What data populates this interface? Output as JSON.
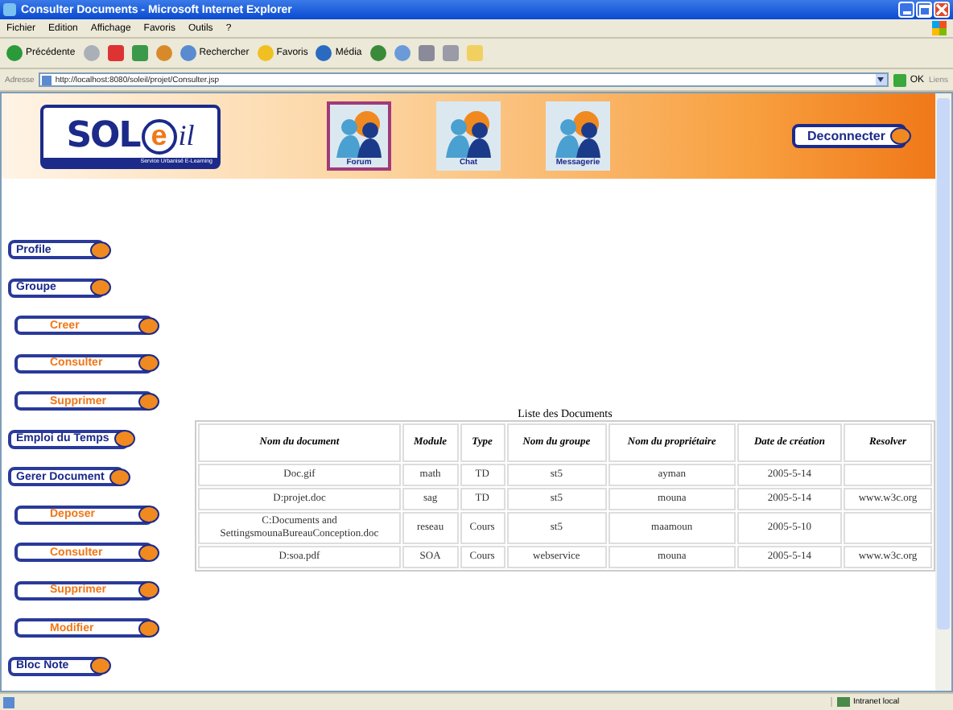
{
  "window": {
    "title": "Consulter Documents - Microsoft Internet Explorer"
  },
  "menu": [
    "Fichier",
    "Edition",
    "Affichage",
    "Favoris",
    "Outils",
    "?"
  ],
  "toolbar": [
    {
      "kind": "back",
      "label": "Précédente"
    },
    {
      "kind": "forward"
    },
    {
      "kind": "stop"
    },
    {
      "kind": "refresh"
    },
    {
      "kind": "home"
    },
    {
      "kind": "search",
      "label": "Rechercher"
    },
    {
      "kind": "favorites",
      "label": "Favoris"
    },
    {
      "kind": "media",
      "label": "Média"
    },
    {
      "kind": "history"
    },
    {
      "kind": "mail"
    },
    {
      "kind": "print"
    },
    {
      "kind": "edit"
    },
    {
      "kind": "folder"
    }
  ],
  "address": {
    "label": "Adresse",
    "url": "http://localhost:8080/soleil/projet/Consulter.jsp",
    "go": "OK",
    "links": "Liens"
  },
  "header": {
    "logo": "SOL",
    "logo_e": "e",
    "logo_end": "il",
    "tagline": "Service Urbanisé E-Learning",
    "nav": [
      {
        "label": "Forum",
        "selected": true
      },
      {
        "label": "Chat",
        "selected": false
      },
      {
        "label": "Messagerie",
        "selected": false
      }
    ],
    "logout": "Deconnecter"
  },
  "sidebar": [
    {
      "label": "Profile",
      "kind": "main"
    },
    {
      "label": "Groupe",
      "kind": "main"
    },
    {
      "label": "Creer",
      "kind": "sub"
    },
    {
      "label": "Consulter",
      "kind": "sub"
    },
    {
      "label": "Supprimer",
      "kind": "sub"
    },
    {
      "label": "Emploi du Temps",
      "kind": "main"
    },
    {
      "label": "Gerer Document",
      "kind": "main"
    },
    {
      "label": "Deposer",
      "kind": "sub"
    },
    {
      "label": "Consulter",
      "kind": "sub"
    },
    {
      "label": "Supprimer",
      "kind": "sub"
    },
    {
      "label": "Modifier",
      "kind": "sub"
    },
    {
      "label": "Bloc Note",
      "kind": "main"
    }
  ],
  "table": {
    "caption": "Liste des Documents",
    "columns": [
      "Nom du document",
      "Module",
      "Type",
      "Nom du groupe",
      "Nom du propriétaire",
      "Date de création",
      "Resolver"
    ],
    "rows": [
      [
        "Doc.gif",
        "math",
        "TD",
        "st5",
        "ayman",
        "2005-5-14",
        ""
      ],
      [
        "D:projet.doc",
        "sag",
        "TD",
        "st5",
        "mouna",
        "2005-5-14",
        "www.w3c.org"
      ],
      [
        "C:Documents and SettingsmounaBureauConception.doc",
        "reseau",
        "Cours",
        "st5",
        "maamoun",
        "2005-5-10",
        ""
      ],
      [
        "D:soa.pdf",
        "SOA",
        "Cours",
        "webservice",
        "mouna",
        "2005-5-14",
        "www.w3c.org"
      ]
    ]
  },
  "status": {
    "zone": "Intranet local"
  }
}
